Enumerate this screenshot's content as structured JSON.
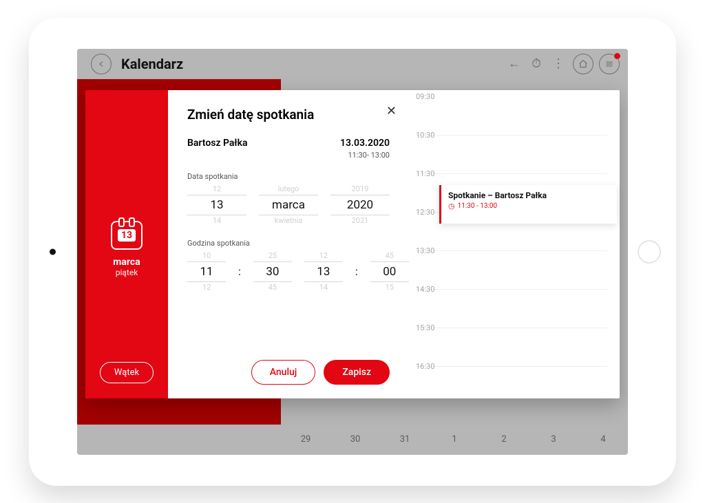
{
  "app": {
    "title": "Kalendarz",
    "notification_count": 1
  },
  "sidebar": {
    "day_number": "13",
    "month": "marca",
    "dow": "piątek",
    "thread_btn": "Wątek"
  },
  "form": {
    "title": "Zmień datę spotkania",
    "person": "Bartosz Pałka",
    "date_text": "13.03.2020",
    "time_text": "11:30- 13:00",
    "date_label": "Data spotkania",
    "time_label": "Godzina spotkania",
    "date_picker": {
      "prev": {
        "d": "12",
        "m": "lutego",
        "y": "2019"
      },
      "sel": {
        "d": "13",
        "m": "marca",
        "y": "2020"
      },
      "next": {
        "d": "14",
        "m": "kwietnia",
        "y": "2021"
      }
    },
    "time_picker": {
      "prev": {
        "h1": "10",
        "m1": "25",
        "h2": "12",
        "m2": "45"
      },
      "sel": {
        "h1": "11",
        "m1": "30",
        "h2": "13",
        "m2": "00"
      },
      "next": {
        "h1": "12",
        "m1": "45",
        "h2": "14",
        "m2": "15"
      }
    },
    "cancel": "Anuluj",
    "save": "Zapisz"
  },
  "agenda": {
    "slots": [
      "09:30",
      "10:30",
      "11:30",
      "12:30",
      "13:30",
      "14:30",
      "15:30",
      "16:30"
    ],
    "event": {
      "title": "Spotkanie – Bartosz Pałka",
      "time": "11:30 - 13:00"
    }
  },
  "days": [
    "29",
    "30",
    "31",
    "1",
    "2",
    "3",
    "4"
  ]
}
